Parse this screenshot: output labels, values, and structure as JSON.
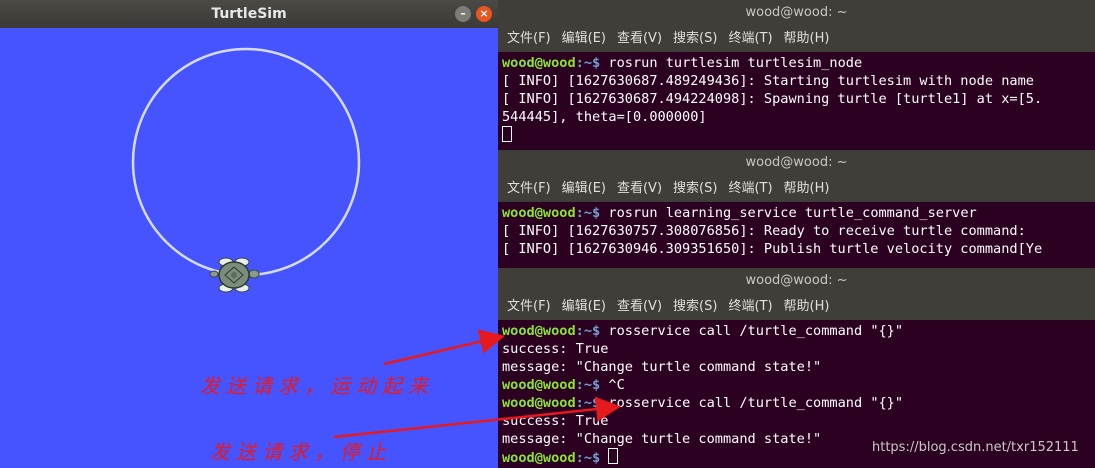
{
  "turtlesim": {
    "title": "TurtleSim",
    "minimize_glyph": "–",
    "close_glyph": "×",
    "background_color": "#4554ff",
    "path_color": "#d6dcff"
  },
  "terminals": [
    {
      "title": "wood@wood: ~",
      "menu": [
        "文件(F)",
        "编辑(E)",
        "查看(V)",
        "搜索(S)",
        "终端(T)",
        "帮助(H)"
      ],
      "prompt_user": "wood@wood",
      "prompt_path": ":~$ ",
      "command": "rosrun turtlesim turtlesim_node",
      "lines": [
        "[ INFO] [1627630687.489249436]: Starting turtlesim with node name",
        "[ INFO] [1627630687.494224098]: Spawning turtle [turtle1] at x=[5.",
        "544445], theta=[0.000000]"
      ]
    },
    {
      "title": "wood@wood: ~",
      "menu": [
        "文件(F)",
        "编辑(E)",
        "查看(V)",
        "搜索(S)",
        "终端(T)",
        "帮助(H)"
      ],
      "prompt_user": "wood@wood",
      "prompt_path": ":~$ ",
      "command": "rosrun learning_service turtle_command_server",
      "lines": [
        "[ INFO] [1627630757.308076856]: Ready to receive turtle command:",
        "[ INFO] [1627630946.309351650]: Publish turtle velocity command[Ye"
      ]
    },
    {
      "title": "wood@wood: ~",
      "menu": [
        "文件(F)",
        "编辑(E)",
        "查看(V)",
        "搜索(S)",
        "终端(T)",
        "帮助(H)"
      ],
      "prompt_user": "wood@wood",
      "prompt_path": ":~$ ",
      "command1": "rosservice call /turtle_command \"{}\"",
      "out1a": "success: True",
      "out1b": "message: \"Change turtle command state!\"",
      "command2": "^C",
      "command3": "rosservice call /turtle_command \"{}\"",
      "out3a": "success: True",
      "out3b": "message: \"Change turtle command state!\""
    }
  ],
  "annotations": {
    "start_label": "发送请求，运动起来",
    "stop_label": "发送请求，停止",
    "arrow_color": "#e6191e"
  },
  "watermark": "https://blog.csdn.net/txr152111"
}
